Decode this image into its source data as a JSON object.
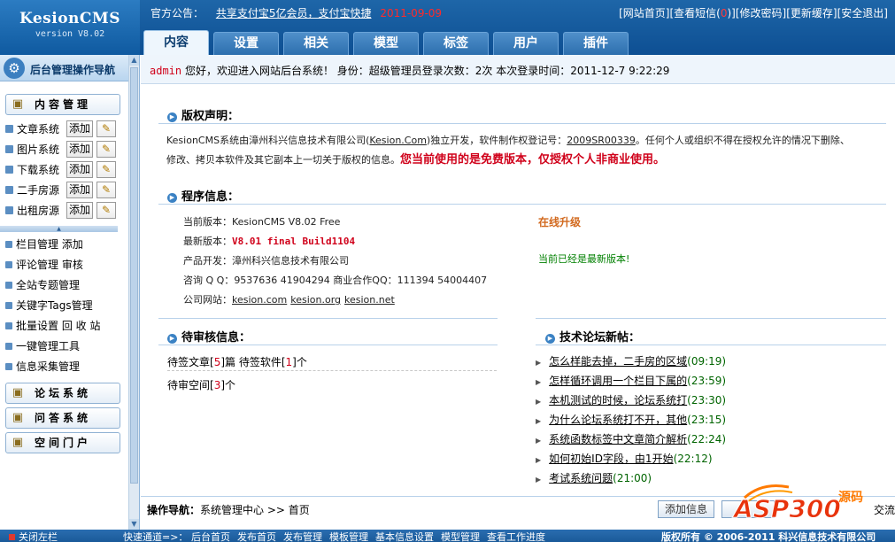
{
  "header": {
    "logo_title": "KesionCMS",
    "logo_version": "version V8.02",
    "notice_label": "官方公告：",
    "notice_text": "共享支付宝5亿会员，支付宝快捷",
    "notice_date": "2011-09-09",
    "top_links": [
      "[网站首页]",
      "[查看短信(",
      "0",
      ")]",
      "[修改密码]",
      "[更新缓存]",
      "[安全退出]"
    ]
  },
  "main_tabs": [
    {
      "label": "内容",
      "active": true
    },
    {
      "label": "设置",
      "active": false
    },
    {
      "label": "相关",
      "active": false
    },
    {
      "label": "模型",
      "active": false
    },
    {
      "label": "标签",
      "active": false
    },
    {
      "label": "用户",
      "active": false
    },
    {
      "label": "插件",
      "active": false
    }
  ],
  "sidebar": {
    "title": "后台管理操作导航",
    "content_section": "内容管理",
    "content_items": [
      {
        "label": "文章系统",
        "add": "添加"
      },
      {
        "label": "图片系统",
        "add": "添加"
      },
      {
        "label": "下载系统",
        "add": "添加"
      },
      {
        "label": "二手房源",
        "add": "添加"
      },
      {
        "label": "出租房源",
        "add": "添加"
      }
    ],
    "menu_items": [
      "栏目管理 添加",
      "评论管理 审核",
      "全站专题管理",
      "关键字Tags管理",
      "批量设置 回 收 站",
      "一键管理工具",
      "信息采集管理"
    ],
    "bottom_sections": [
      "论坛系统",
      "问答系统",
      "空间门户"
    ]
  },
  "welcome": {
    "user": "admin",
    "text": " 您好，欢迎进入网站后台系统！ 身份：超级管理员登录次数：2次 本次登录时间：2011-12-7 9:22:29"
  },
  "copyright": {
    "title": "版权声明：",
    "line1_a": "KesionCMS系统由漳州科兴信息技术有限公司(",
    "line1_link": "Kesion.Com",
    "line1_b": ")独立开发，软件制作权登记号：",
    "reg_no": "2009SR00339",
    "line1_c": "。任何个人或组织不得在授权允许的情况下删除、",
    "line2_a": "修改、拷贝本软件及其它副本上一切关于版权的信息。",
    "line2_red": "您当前使用的是免费版本，仅授权个人非商业使用。"
  },
  "program": {
    "title": "程序信息：",
    "current_label": "当前版本：",
    "current_value": "KesionCMS V8.02 Free",
    "latest_label": "最新版本：",
    "latest_value": "V8.01 final Build1104",
    "dev_label": "产品开发：",
    "dev_value": "漳州科兴信息技术有限公司",
    "contact_label": "咨询 Q Q：",
    "contact_value": "9537636 41904294 商业合作QQ：111394 54004407",
    "site_label": "公司网站：",
    "sites": [
      "kesion.com",
      "kesion.org",
      "kesion.net"
    ],
    "upgrade": "在线升级",
    "latest_msg": "当前已经是最新版本!"
  },
  "pending": {
    "title": "待审核信息：",
    "articles_a": "待签文章[",
    "articles_n": "5",
    "articles_b": "]篇 待签软件[",
    "software_n": "1",
    "articles_c": "]个",
    "space_a": "待审空间[",
    "space_n": "3",
    "space_b": "]个"
  },
  "forum": {
    "title": "技术论坛新帖：",
    "posts": [
      {
        "title": "怎么样能去掉，二手房的区域",
        "time": "(09:19)"
      },
      {
        "title": "怎样循环调用一个栏目下属的",
        "time": "(23:59)"
      },
      {
        "title": "本机测试的时候，论坛系统打",
        "time": "(23:30)"
      },
      {
        "title": "为什么论坛系统打不开，其他",
        "time": "(23:15)"
      },
      {
        "title": "系统函数标签中文章简介解析",
        "time": "(22:24)"
      },
      {
        "title": "如何初始ID字段，由1开始",
        "time": "(22:12)"
      },
      {
        "title": "考试系统问题",
        "time": "(21:00)"
      }
    ]
  },
  "nav": {
    "label": "操作导航：",
    "path": "系统管理中心 >> 首页",
    "add_button": "添加信息",
    "exchange": "交流"
  },
  "watermark": {
    "main": "ASP300",
    "suffix": "源码"
  },
  "bottom": {
    "close_left": "关闭左栏",
    "quick_label": "快速通道=>：",
    "quick_links": [
      "后台首页",
      "发布首页",
      "发布管理",
      "模板管理",
      "基本信息设置",
      "模型管理",
      "查看工作进度"
    ],
    "copyright": "版权所有 © 2006-2011 科兴信息技术有限公司"
  }
}
